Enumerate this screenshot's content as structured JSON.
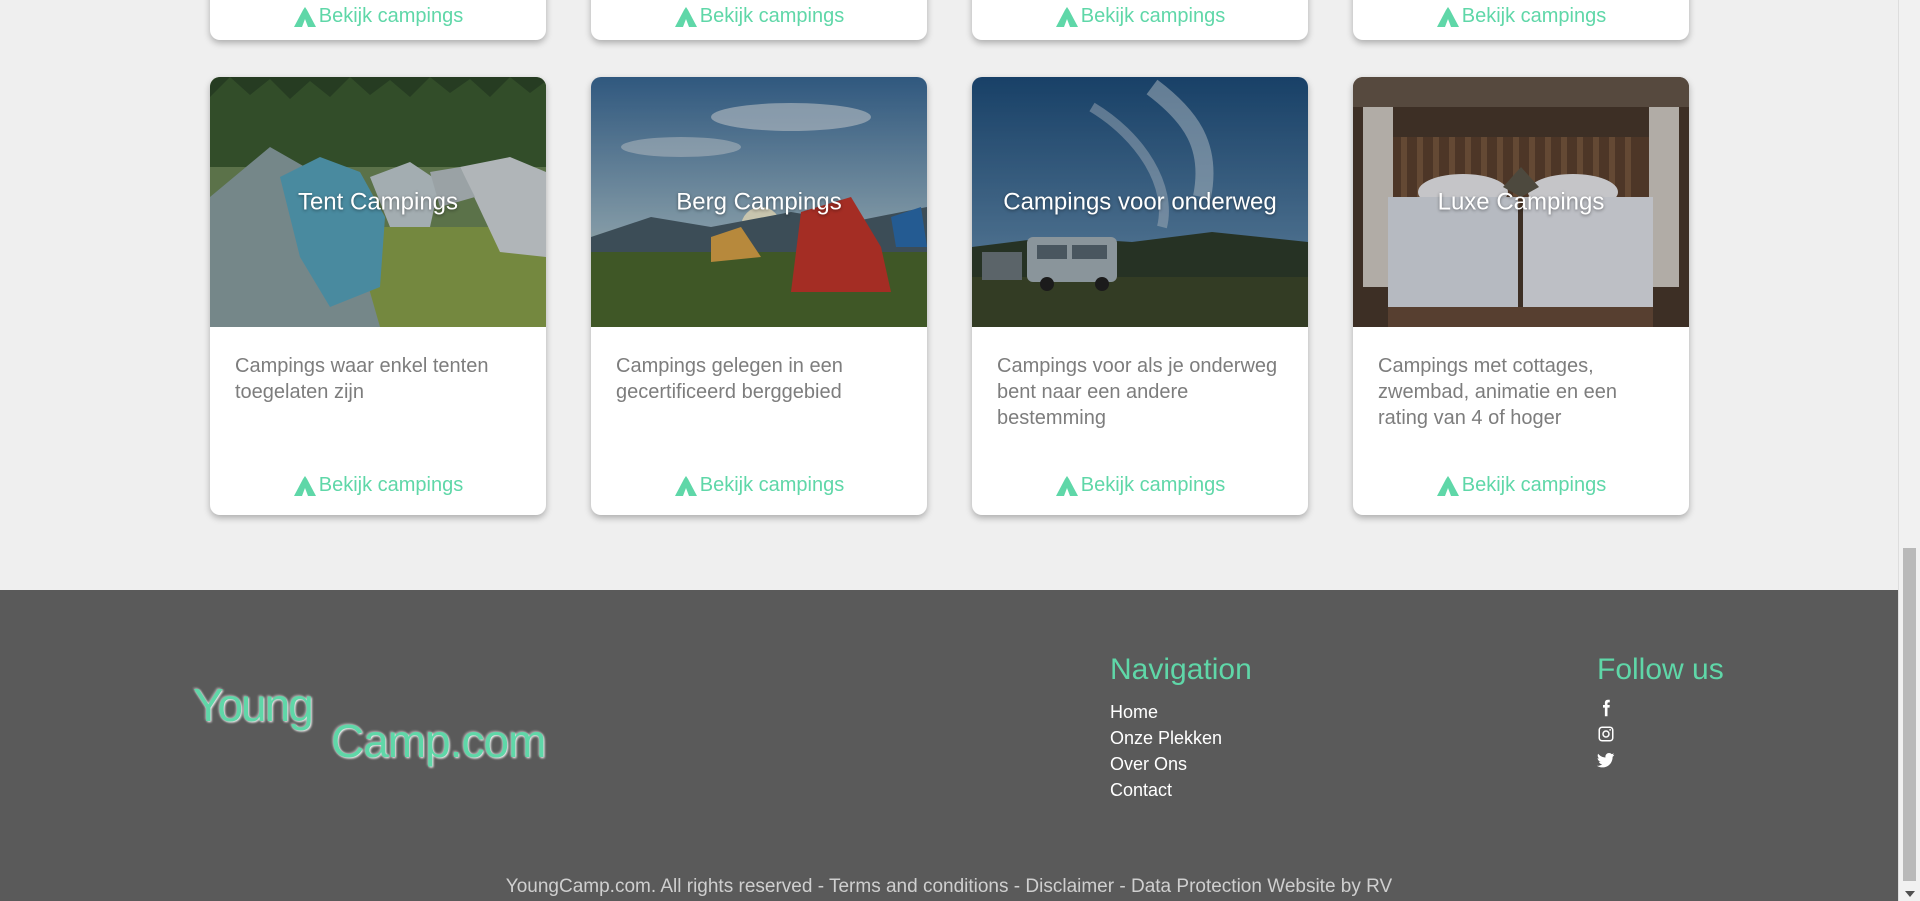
{
  "top_row": [
    {
      "link": "Bekijk campings"
    },
    {
      "link": "Bekijk campings"
    },
    {
      "link": "Bekijk campings"
    },
    {
      "link": "Bekijk campings"
    }
  ],
  "cards": [
    {
      "title": "Tent Campings",
      "description": "Campings waar enkel tenten toegelaten zijn",
      "link": "Bekijk campings"
    },
    {
      "title": "Berg Campings",
      "description": "Campings gelegen in een gecertificeerd berggebied",
      "link": "Bekijk campings"
    },
    {
      "title": "Campings voor onderweg",
      "description": "Campings voor als je onderweg bent naar een andere bestemming",
      "link": "Bekijk campings"
    },
    {
      "title": "Luxe Campings",
      "description": "Campings met cottages, zwembad, animatie en een rating van 4 of hoger",
      "link": "Bekijk campings"
    }
  ],
  "footer": {
    "logo_line1": "Young",
    "logo_line2": "Camp.com",
    "navigation_title": "Navigation",
    "nav_links": [
      "Home",
      "Onze Plekken",
      "Over Ons",
      "Contact"
    ],
    "follow_title": "Follow us",
    "social_icons": [
      "facebook-icon",
      "instagram-icon",
      "twitter-icon"
    ],
    "copyright": {
      "site": "YoungCamp.com. All rights reserved",
      "sep1": " - ",
      "terms": "Terms and conditions",
      "sep2": " - ",
      "disclaimer": "Disclaimer",
      "sep3": " - ",
      "data_protection": "Data Protection",
      "credit": " Website by RV"
    }
  },
  "colors": {
    "accent": "#5fd7a8",
    "footer_bg": "#5a5a5a",
    "page_bg": "#efefef"
  }
}
